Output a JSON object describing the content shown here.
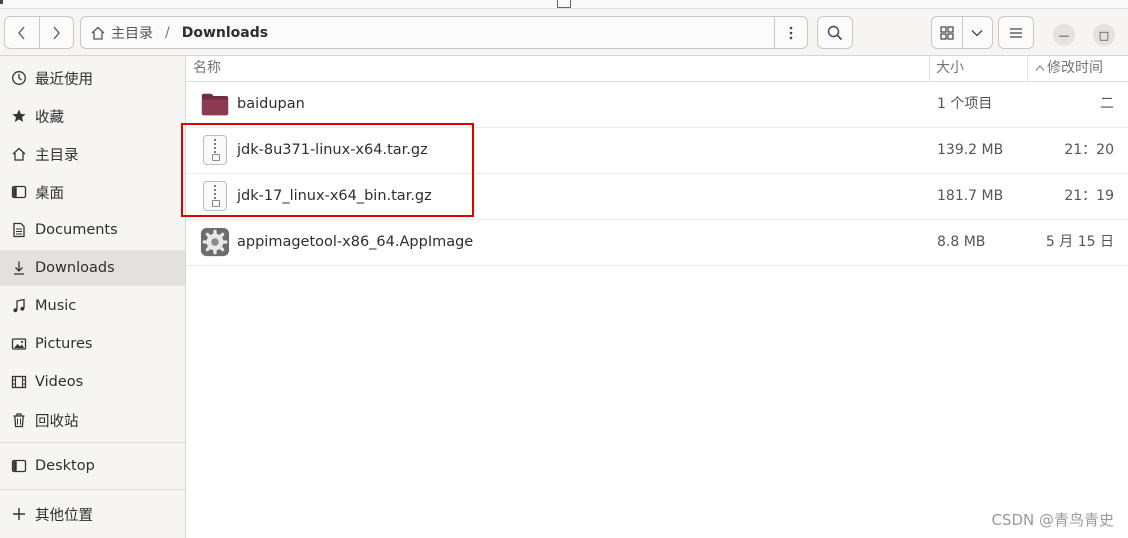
{
  "path": {
    "home_label": "主目录",
    "separator": "/",
    "current": "Downloads"
  },
  "sidebar": {
    "items": [
      {
        "label": "最近使用",
        "icon": "clock-icon"
      },
      {
        "label": "收藏",
        "icon": "star-icon"
      },
      {
        "label": "主目录",
        "icon": "home-icon"
      },
      {
        "label": "桌面",
        "icon": "desktop-icon"
      },
      {
        "label": "Documents",
        "icon": "document-icon"
      },
      {
        "label": "Downloads",
        "icon": "download-icon",
        "active": true
      },
      {
        "label": "Music",
        "icon": "music-icon"
      },
      {
        "label": "Pictures",
        "icon": "picture-icon"
      },
      {
        "label": "Videos",
        "icon": "video-icon"
      },
      {
        "label": "回收站",
        "icon": "trash-icon"
      },
      {
        "label": "Desktop",
        "icon": "drive-icon"
      },
      {
        "label": "其他位置",
        "icon": "plus-icon"
      }
    ]
  },
  "columns": {
    "name": "名称",
    "size": "大小",
    "modified": "修改时间"
  },
  "files": [
    {
      "name": "baidupan",
      "size": "1 个项目",
      "modified": "二",
      "icon": "folder-icon"
    },
    {
      "name": "jdk-8u371-linux-x64.tar.gz",
      "size": "139.2 MB",
      "modified": "21：20",
      "icon": "archive-icon"
    },
    {
      "name": "jdk-17_linux-x64_bin.tar.gz",
      "size": "181.7 MB",
      "modified": "21：19",
      "icon": "archive-icon"
    },
    {
      "name": "appimagetool-x86_64.AppImage",
      "size": "8.8 MB",
      "modified": "5 月 15 日",
      "icon": "gear-icon"
    }
  ],
  "window_controls": {
    "minimize": "—",
    "maximize": "□"
  },
  "watermark": "CSDN @青鸟青史",
  "colors": {
    "highlight": "#e00000",
    "folder": "#8b3a52",
    "sidebar_bg": "#f6f5f4"
  }
}
